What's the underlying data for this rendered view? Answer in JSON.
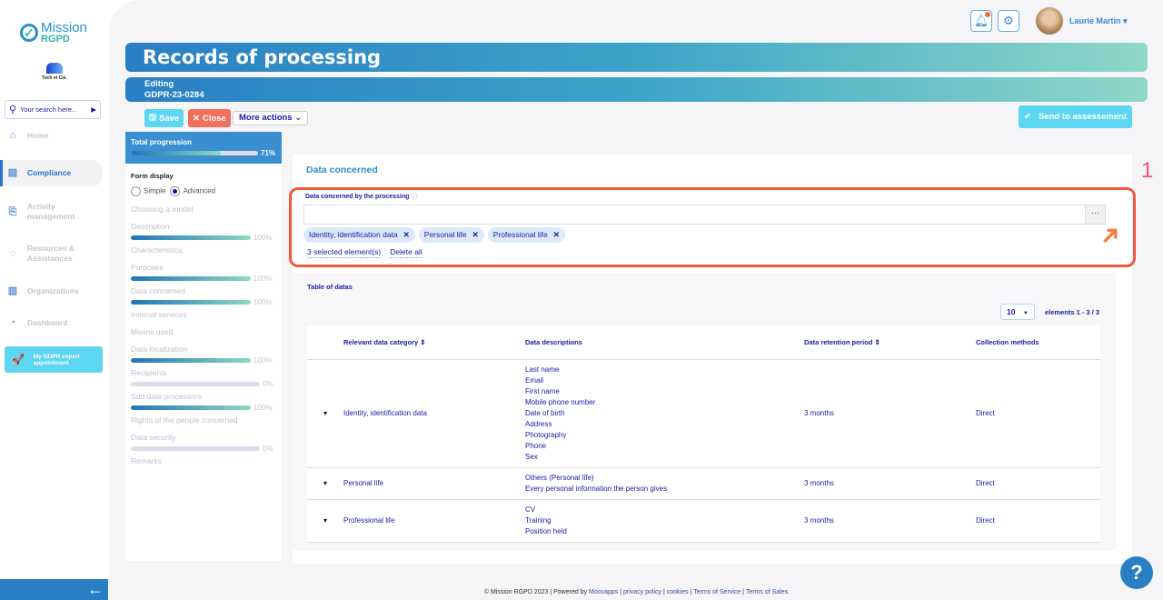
{
  "brand": {
    "name_top": "Mission",
    "name_bottom": "RGPD",
    "company": "Tech et Cie."
  },
  "search": {
    "placeholder": "Your search here.."
  },
  "nav": [
    {
      "label": "Home",
      "icon": "home-icon",
      "active": false
    },
    {
      "label": "Compliance",
      "icon": "document-icon",
      "active": true
    },
    {
      "label": "Activity management",
      "icon": "bookmark-icon",
      "active": false
    },
    {
      "label": "Resources & Assistances",
      "icon": "chat-icon",
      "active": false
    },
    {
      "label": "Organizations",
      "icon": "building-icon",
      "active": false
    },
    {
      "label": "Dashboard",
      "icon": "dashboard-icon",
      "active": false
    }
  ],
  "gdpr_button": "My GDPR expert appointment",
  "user": {
    "name": "Laurie Martin"
  },
  "header": {
    "title": "Records of processing",
    "status": "Editing",
    "reference": "GDPR-23-0284"
  },
  "toolbar": {
    "save": "Save",
    "close": "Close",
    "more": "More actions",
    "send": "Send to assessement"
  },
  "progress": {
    "label": "Total progression",
    "value": 71,
    "value_label": "71%"
  },
  "form_display": {
    "label": "Form display",
    "simple": "Simple",
    "advanced": "Advanced",
    "selected": "Advanced"
  },
  "steps": [
    {
      "label": "Choosing a model"
    },
    {
      "label": "Description",
      "pct": 100,
      "pct_label": "100%"
    },
    {
      "label": "Characteristics"
    },
    {
      "label": "Purposes",
      "pct": 100,
      "pct_label": "100%"
    },
    {
      "label": "Data concerned",
      "pct": 100,
      "pct_label": "100%"
    },
    {
      "label": "Internal services"
    },
    {
      "label": "Means used"
    },
    {
      "label": "Data localization",
      "pct": 100,
      "pct_label": "100%"
    },
    {
      "label": "Recipients",
      "pct": 0,
      "pct_label": "0%"
    },
    {
      "label": "Sub data processors",
      "pct": 100,
      "pct_label": "100%"
    },
    {
      "label": "Rights of the people concerned"
    },
    {
      "label": "Data security",
      "pct": 0,
      "pct_label": "0%"
    },
    {
      "label": "Remarks"
    }
  ],
  "section": {
    "title": "Data concerned",
    "field_label": "Data concerned by the processing",
    "dots": "···",
    "chips": [
      "Identity, identification data",
      "Personal life",
      "Professional life"
    ],
    "selected_count": "3 selected element(s)",
    "delete_all": "Delete all",
    "step_number": "1"
  },
  "table": {
    "title": "Table of datas",
    "page_size": "10",
    "elements": "elements 1 - 3 / 3",
    "headers": [
      "Relevant data category",
      "Data descriptions",
      "Data retention period",
      "Collection methods"
    ],
    "rows": [
      {
        "category": "Identity, identification data",
        "descriptions": [
          "Last name",
          "Email",
          "First name",
          "Mobile phone number",
          "Date of birth",
          "Address",
          "Photography",
          "Phone",
          "Sex"
        ],
        "retention": "3 months",
        "method": "Direct"
      },
      {
        "category": "Personal life",
        "descriptions": [
          "Others (Personal life)",
          "Every personal information the person gives"
        ],
        "retention": "3 months",
        "method": "Direct"
      },
      {
        "category": "Professional life",
        "descriptions": [
          "CV",
          "Training",
          "Position held"
        ],
        "retention": "3 months",
        "method": "Direct"
      }
    ]
  },
  "footer": {
    "copyright": "© Mission RGPD 2023 | Powered by ",
    "moovapps": "Moovapps",
    "privacy": "privacy policy",
    "cookies": "cookies",
    "tos": "Terms of Service",
    "tosales": "Terms of Sales",
    "sep": " | "
  },
  "help": "?"
}
